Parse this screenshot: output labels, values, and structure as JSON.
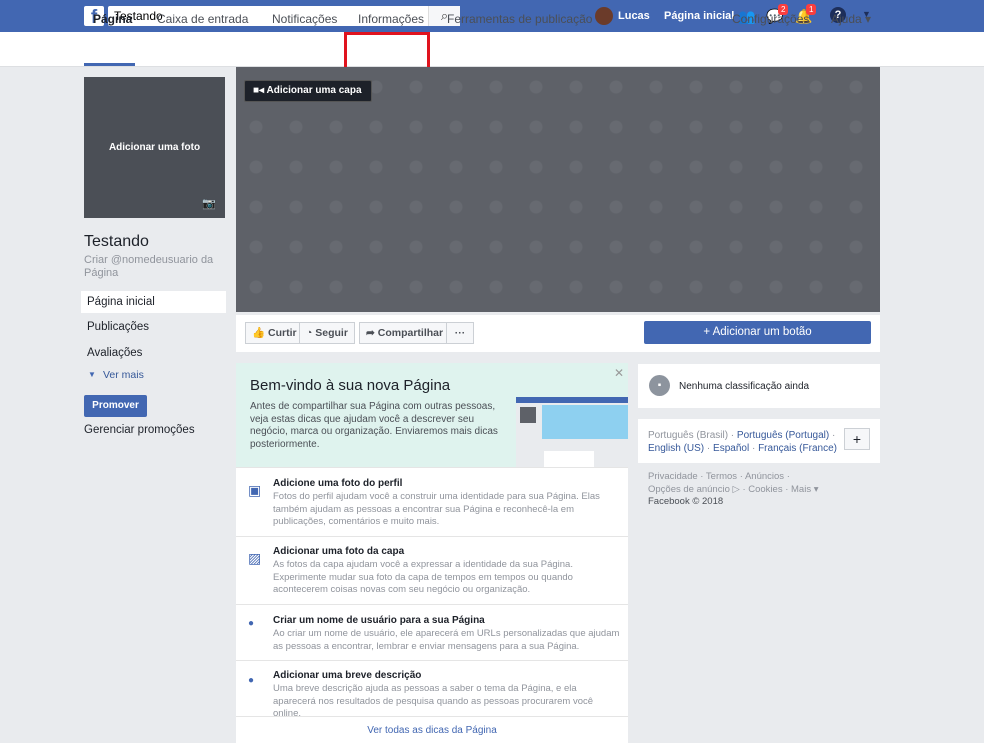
{
  "topbar": {
    "search_value": "Testando",
    "user": "Lucas",
    "home": "Página inicial",
    "messages_badge": "2",
    "notifications_badge": "1"
  },
  "nav": {
    "tabs": [
      "Página",
      "Caixa de entrada",
      "Notificações",
      "Informações",
      "Ferramentas de publicação"
    ],
    "settings": "Configurações",
    "help": "Ajuda ▾"
  },
  "sidebar": {
    "add_photo": "Adicionar uma foto",
    "page_name": "Testando",
    "username": "Criar @nomedeusuario da Página",
    "items": [
      "Página inicial",
      "Publicações",
      "Avaliações"
    ],
    "see_more": "Ver mais",
    "promote": "Promover",
    "manage": "Gerenciar promoções"
  },
  "cover": {
    "add_cover": "Adicionar uma capa"
  },
  "actions": {
    "like": "Curtir",
    "follow": "Seguir",
    "share": "Compartilhar",
    "more": "···",
    "add_button": "+ Adicionar um botão"
  },
  "welcome": {
    "title": "Bem-vindo à sua nova Página",
    "desc": "Antes de compartilhar sua Página com outras pessoas, veja estas dicas que ajudam você a descrever seu negócio, marca ou organização. Enviaremos mais dicas posteriormente.",
    "tips": [
      {
        "title": "Adicione uma foto do perfil",
        "desc": "Fotos do perfil ajudam você a construir uma identidade para sua Página. Elas também ajudam as pessoas a encontrar sua Página e reconhecê-la em publicações, comentários e muito mais."
      },
      {
        "title": "Adicionar uma foto da capa",
        "desc": "As fotos da capa ajudam você a expressar a identidade da sua Página. Experimente mudar sua foto da capa de tempos em tempos ou quando acontecerem coisas novas com seu negócio ou organização."
      },
      {
        "title": "Criar um nome de usuário para a sua Página",
        "desc": "Ao criar um nome de usuário, ele aparecerá em URLs personalizadas que ajudam as pessoas a encontrar, lembrar e enviar mensagens para a sua Página."
      },
      {
        "title": "Adicionar uma breve descrição",
        "desc": "Uma breve descrição ajuda as pessoas a saber o tema da Página, e ela aparecerá nos resultados de pesquisa quando as pessoas procurarem você online."
      }
    ],
    "see_all": "Ver todas as dicas da Página"
  },
  "right": {
    "rating": "Nenhuma classificação ainda",
    "lang_current": "Português (Brasil)",
    "langs": [
      "Português (Portugal)",
      "English (US)",
      "Español",
      "Français (France)"
    ],
    "footer1": "Privacidade · Termos · Anúncios ·",
    "footer2": "Opções de anúncio ▷ · Cookies · Mais ▾",
    "footer3": "Facebook © 2018"
  }
}
